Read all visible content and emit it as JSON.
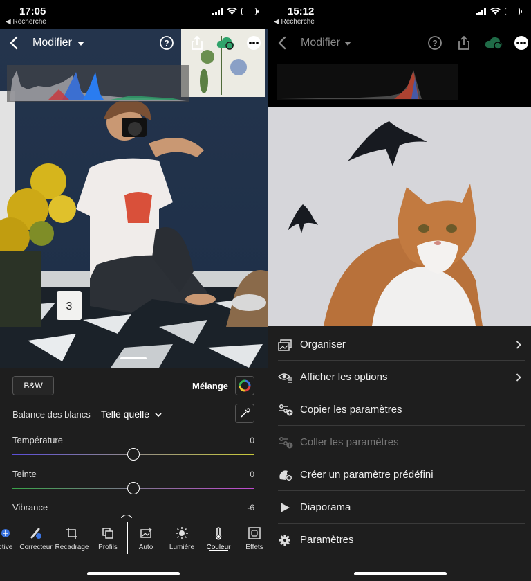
{
  "left": {
    "status": {
      "time": "17:05",
      "back_app": "◀ Recherche"
    },
    "toolbar": {
      "title": "Modifier"
    },
    "panel": {
      "bw_label": "B&W",
      "mix_label": "Mélange",
      "wb_label": "Balance des blancs",
      "wb_value": "Telle quelle",
      "sliders": [
        {
          "label": "Température",
          "value": "0",
          "level": 0.5
        },
        {
          "label": "Teinte",
          "value": "0",
          "level": 0.5
        },
        {
          "label": "Vibrance",
          "value": "-6",
          "level": 0.47
        }
      ]
    },
    "tools": [
      {
        "label": "ctive",
        "icon": "selective-icon"
      },
      {
        "label": "Correcteur",
        "icon": "healing-icon"
      },
      {
        "label": "Recadrage",
        "icon": "crop-icon"
      },
      {
        "label": "Profils",
        "icon": "profiles-icon"
      },
      {
        "label": "Auto",
        "icon": "auto-icon"
      },
      {
        "label": "Lumière",
        "icon": "light-icon"
      },
      {
        "label": "Couleur",
        "icon": "thermometer-icon"
      },
      {
        "label": "Effets",
        "icon": "effects-icon"
      }
    ],
    "active_tool": "Couleur"
  },
  "right": {
    "status": {
      "time": "15:12",
      "back_app": "◀ Recherche"
    },
    "toolbar": {
      "title": "Modifier"
    },
    "menu": [
      {
        "label": "Organiser",
        "icon": "organize-icon",
        "chevron": true,
        "enabled": true
      },
      {
        "label": "Afficher les options",
        "icon": "view-options-icon",
        "chevron": true,
        "enabled": true
      },
      {
        "label": "Copier les paramètres",
        "icon": "copy-settings-icon",
        "chevron": false,
        "enabled": true
      },
      {
        "label": "Coller les paramètres",
        "icon": "paste-settings-icon",
        "chevron": false,
        "enabled": false
      },
      {
        "label": "Créer un paramètre prédéfini",
        "icon": "create-preset-icon",
        "chevron": false,
        "enabled": true
      },
      {
        "label": "Diaporama",
        "icon": "play-icon",
        "chevron": false,
        "enabled": true
      },
      {
        "label": "Paramètres",
        "icon": "gear-icon",
        "chevron": false,
        "enabled": true
      }
    ]
  },
  "colors": {
    "accent_green": "#2fa36b",
    "panel_bg": "#1e1e1e",
    "disabled_text": "#777777"
  }
}
